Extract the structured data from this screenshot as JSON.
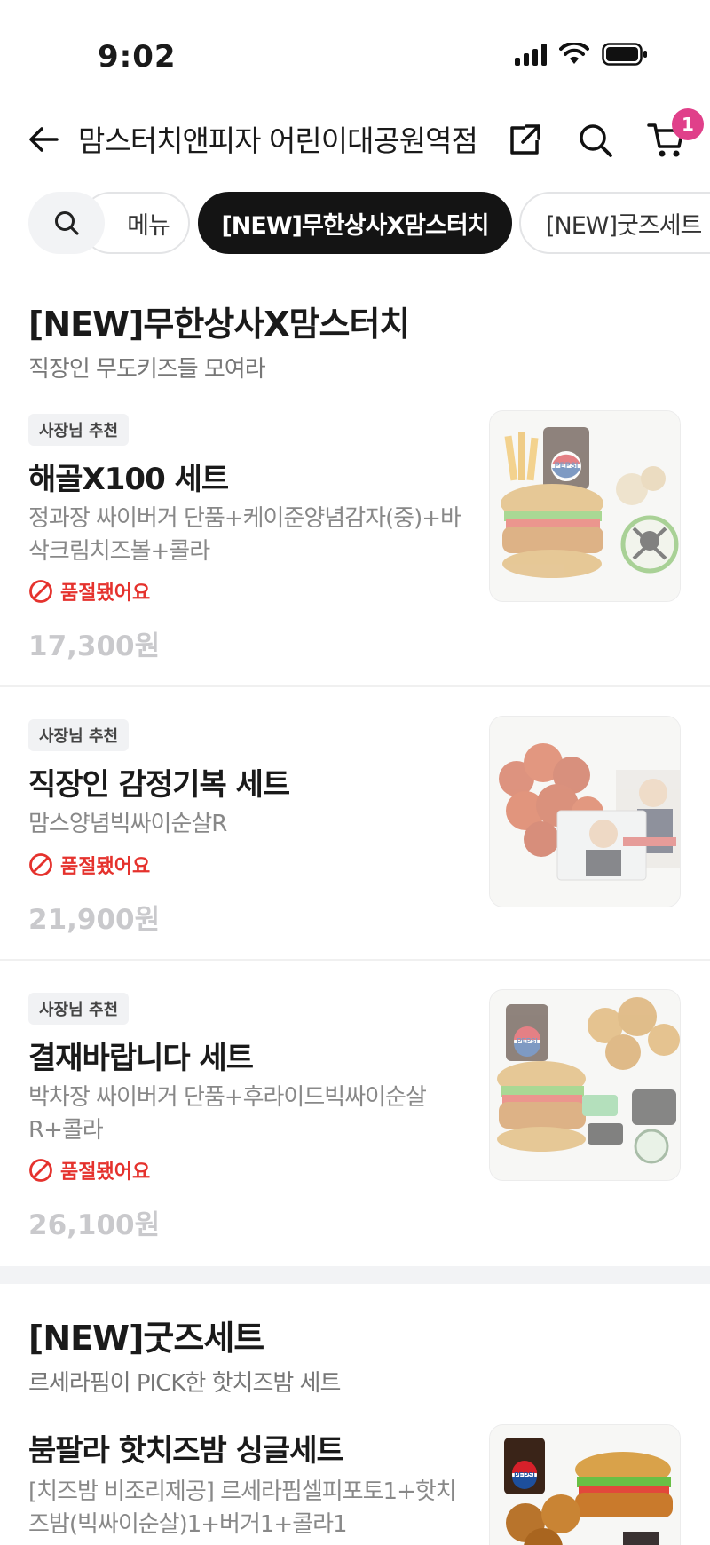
{
  "status": {
    "time": "9:02"
  },
  "header": {
    "store_name": "맘스터치앤피자 어린이대공원역점",
    "cart_count": "1"
  },
  "tabs": [
    {
      "label": "메뉴"
    },
    {
      "label": "[NEW]무한상사X맘스터치"
    },
    {
      "label": "[NEW]굿즈세트"
    }
  ],
  "sections": [
    {
      "title": "[NEW]무한상사X맘스터치",
      "subtitle": "직장인 무도키즈들 모여라",
      "items": [
        {
          "badge": "사장님 추천",
          "name": "해골X100 세트",
          "desc": "정과장 싸이버거 단품+케이준양념감자(중)+바삭크림치즈볼+콜라",
          "soldout": "품절됐어요",
          "price": "17,300원"
        },
        {
          "badge": "사장님 추천",
          "name": "직장인 감정기복 세트",
          "desc": "맘스양념빅싸이순살R",
          "soldout": "품절됐어요",
          "price": "21,900원"
        },
        {
          "badge": "사장님 추천",
          "name": "결재바랍니다 세트",
          "desc": "박차장 싸이버거 단품+후라이드빅싸이순살R+콜라",
          "soldout": "품절됐어요",
          "price": "26,100원"
        }
      ]
    },
    {
      "title": "[NEW]굿즈세트",
      "subtitle": "르세라핌이 PICK한 핫치즈밤 세트",
      "items": [
        {
          "name": "붐팔라 핫치즈밤 싱글세트",
          "desc": "[치즈밤 비조리제공] 르세라핌셀피포토1+핫치즈밤(빅싸이순살)1+버거1+콜라1"
        }
      ]
    }
  ],
  "image_text": {
    "pepsi": "PEPSI"
  },
  "colors": {
    "accent_badge": "#e0408a",
    "soldout": "#e5322d",
    "active_chip": "#141414"
  }
}
